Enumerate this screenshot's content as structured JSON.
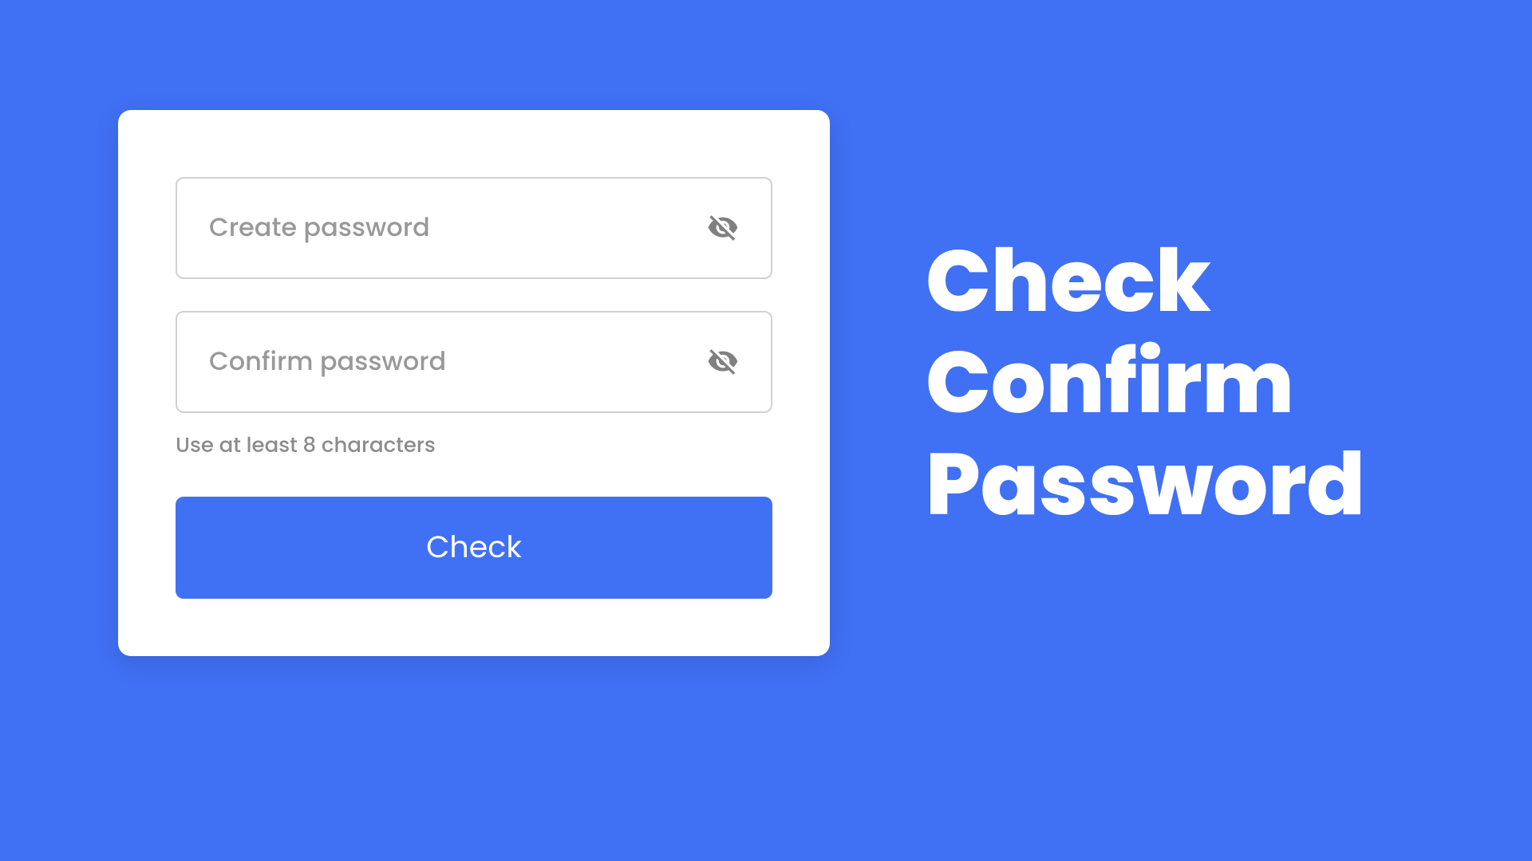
{
  "form": {
    "create_password_placeholder": "Create password",
    "confirm_password_placeholder": "Confirm password",
    "hint_text": "Use at least 8 characters",
    "check_button_label": "Check"
  },
  "heading": {
    "line1": "Check",
    "line2": "Confirm",
    "line3": "Password"
  },
  "colors": {
    "primary": "#4070f4",
    "card_bg": "#ffffff",
    "border": "#d1d1d1",
    "placeholder": "#999999",
    "icon": "#808080",
    "hint": "#8c8c8c"
  }
}
